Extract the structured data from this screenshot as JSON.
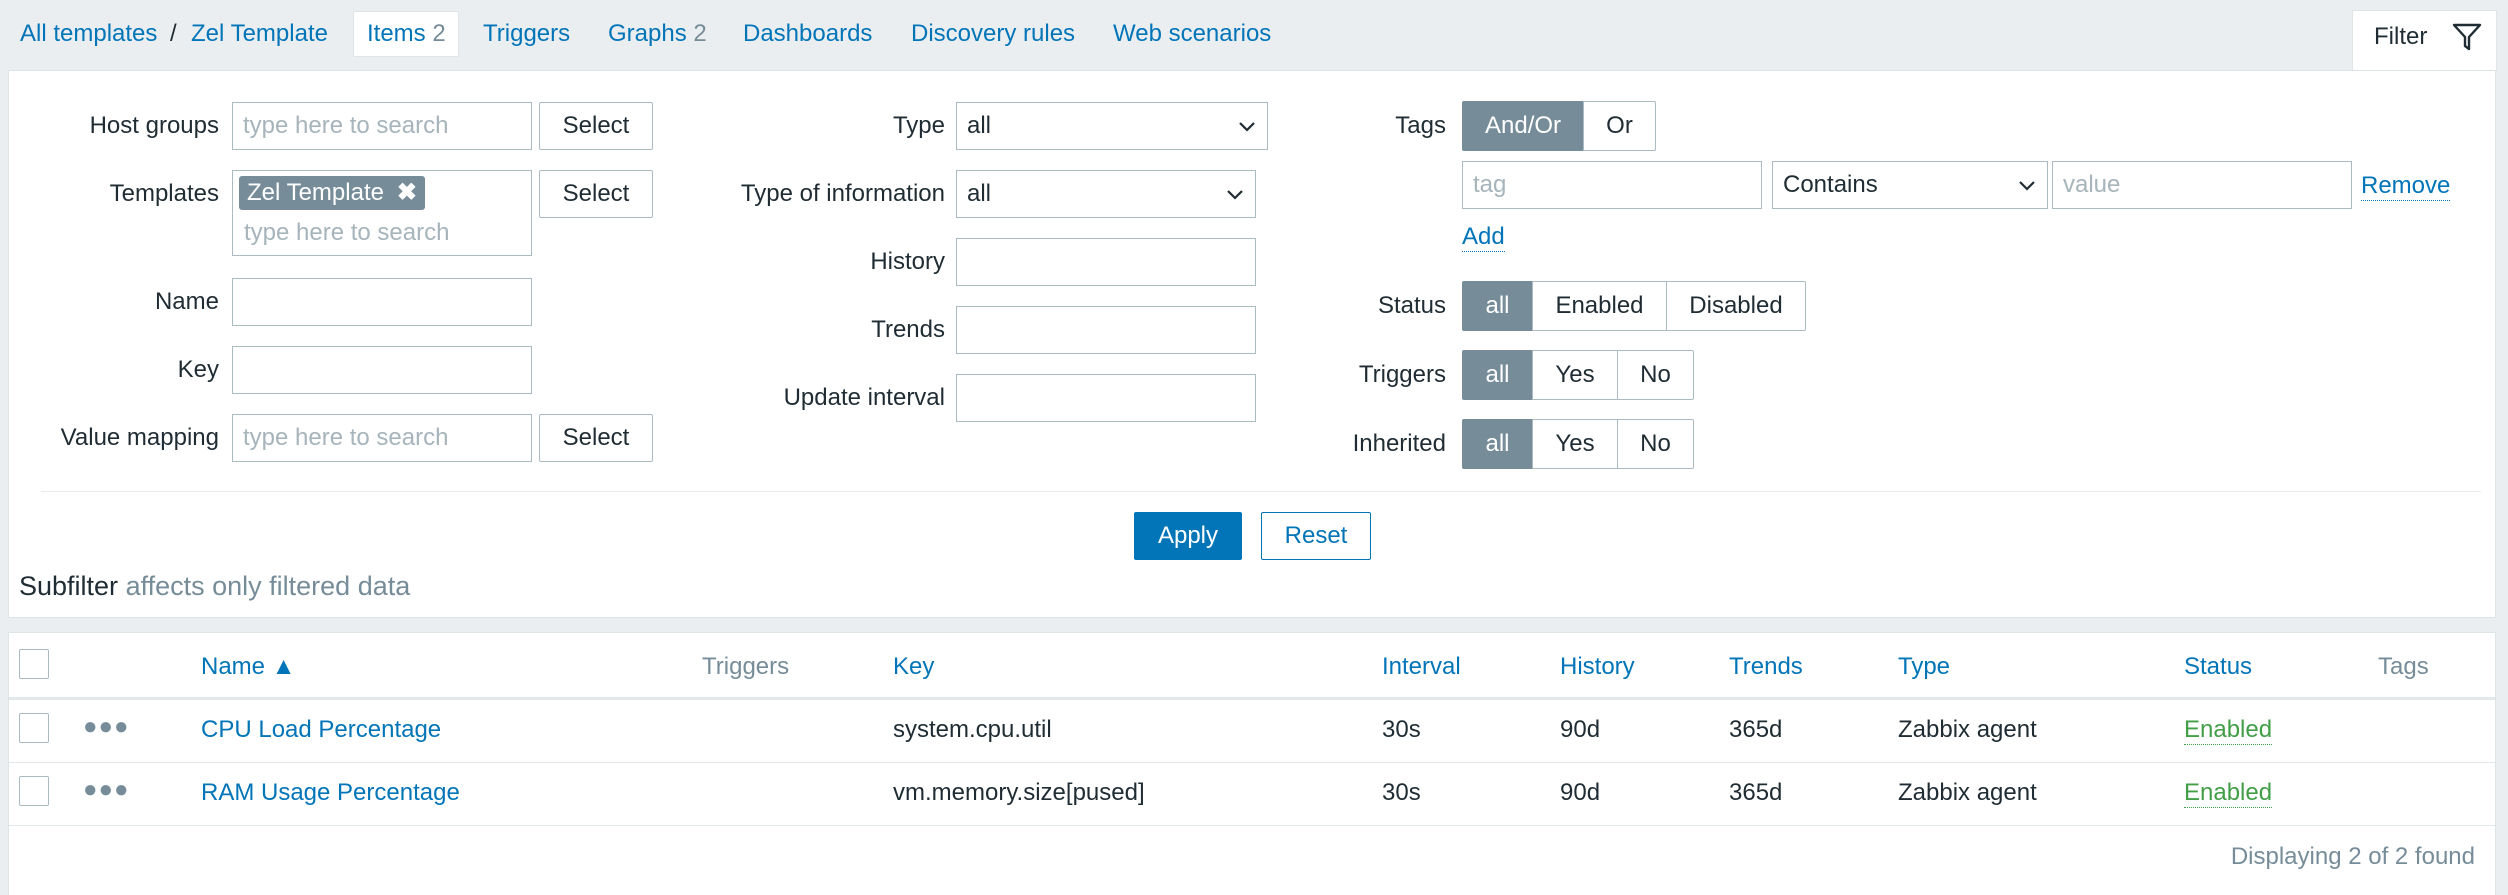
{
  "nav": {
    "all_templates": "All templates",
    "separator": "/",
    "template": "Zel Template",
    "tabs": {
      "items": {
        "label": "Items",
        "count": "2"
      },
      "triggers": {
        "label": "Triggers"
      },
      "graphs": {
        "label": "Graphs",
        "count": "2"
      },
      "dashboards": {
        "label": "Dashboards"
      },
      "discovery": {
        "label": "Discovery rules"
      },
      "web": {
        "label": "Web scenarios"
      }
    },
    "filter_label": "Filter"
  },
  "filter": {
    "host_groups": {
      "label": "Host groups",
      "placeholder": "type here to search",
      "button": "Select"
    },
    "templates": {
      "label": "Templates",
      "chip": "Zel Template",
      "chip_remove": "✖",
      "placeholder": "type here to search",
      "button": "Select"
    },
    "name": {
      "label": "Name",
      "value": ""
    },
    "key": {
      "label": "Key",
      "value": ""
    },
    "value_mapping": {
      "label": "Value mapping",
      "placeholder": "type here to search",
      "button": "Select"
    },
    "type": {
      "label": "Type",
      "value": "all"
    },
    "type_of_information": {
      "label": "Type of information",
      "value": "all"
    },
    "history": {
      "label": "History",
      "value": ""
    },
    "trends": {
      "label": "Trends",
      "value": ""
    },
    "update_interval": {
      "label": "Update interval",
      "value": ""
    },
    "tags": {
      "label": "Tags",
      "mode": [
        "And/Or",
        "Or"
      ],
      "tag_placeholder": "tag",
      "operator": "Contains",
      "value_placeholder": "value",
      "remove": "Remove",
      "add": "Add"
    },
    "status": {
      "label": "Status",
      "options": [
        "all",
        "Enabled",
        "Disabled"
      ]
    },
    "triggers": {
      "label": "Triggers",
      "options": [
        "all",
        "Yes",
        "No"
      ]
    },
    "inherited": {
      "label": "Inherited",
      "options": [
        "all",
        "Yes",
        "No"
      ]
    },
    "apply": "Apply",
    "reset": "Reset"
  },
  "subfilter": {
    "title": "Subfilter",
    "note": "affects only filtered data"
  },
  "table": {
    "headers": {
      "name": "Name ▲",
      "triggers": "Triggers",
      "key": "Key",
      "interval": "Interval",
      "history": "History",
      "trends": "Trends",
      "type": "Type",
      "status": "Status",
      "tags": "Tags"
    },
    "rows": [
      {
        "name": "CPU Load Percentage",
        "key": "system.cpu.util",
        "interval": "30s",
        "history": "90d",
        "trends": "365d",
        "type": "Zabbix agent",
        "status": "Enabled"
      },
      {
        "name": "RAM Usage Percentage",
        "key": "vm.memory.size[pused]",
        "interval": "30s",
        "history": "90d",
        "trends": "365d",
        "type": "Zabbix agent",
        "status": "Enabled"
      }
    ],
    "footer": "Displaying 2 of 2 found"
  },
  "colors": {
    "link": "#0275b8",
    "enabled": "#429e47",
    "toggle_on": "#768d99",
    "primary": "#0275b8"
  }
}
